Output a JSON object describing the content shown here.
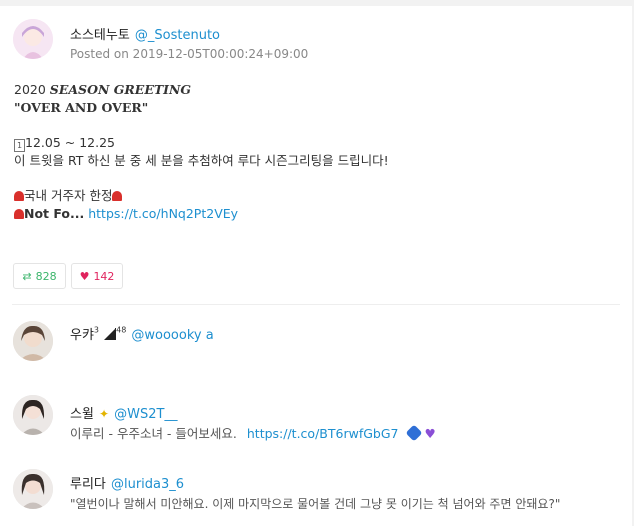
{
  "main_tweet": {
    "display_name": "소스테누토",
    "handle": "@_Sostenuto",
    "posted_label": "Posted on 2019-12-05T00:00:24+09:00",
    "line_year": "2020",
    "line_title": "SEASON GREETING",
    "line_quote": "\"OVER AND OVER\"",
    "line_date_prefix": "1",
    "line_date": "12.05 ~ 12.25",
    "line_body": "이 트윗을 RT 하신 분 중 세 분을 추첨하여 루다 시즌그리팅을 드립니다!",
    "line_domestic": "국내 거주자 한정",
    "line_not_for": "Not Fo...",
    "link": "https://t.co/hNq2Pt2VEy",
    "retweet_count": "828",
    "like_count": "142"
  },
  "replies": [
    {
      "display_name": "우캬",
      "name_suffix": "3",
      "bars_label": "48",
      "handle": "@wooooky a",
      "text": "",
      "link": ""
    },
    {
      "display_name": "스윌",
      "handle": "@WS2T__",
      "text": "이루리 - 우주소녀 - 들어보세요.",
      "link": "https://t.co/BT6rwfGbG7"
    },
    {
      "display_name": "루리다",
      "handle": "@lurida3_6",
      "text": "\"열번이나 말해서 미안해요. 이제 마지막으로 물어볼 건데 그냥 못 이기는 척 넘어와 주면 안돼요?\"",
      "link": ""
    }
  ],
  "colors": {
    "accent": "#1d8fcf",
    "retweet": "#3bb56b",
    "like": "#e0245e"
  }
}
